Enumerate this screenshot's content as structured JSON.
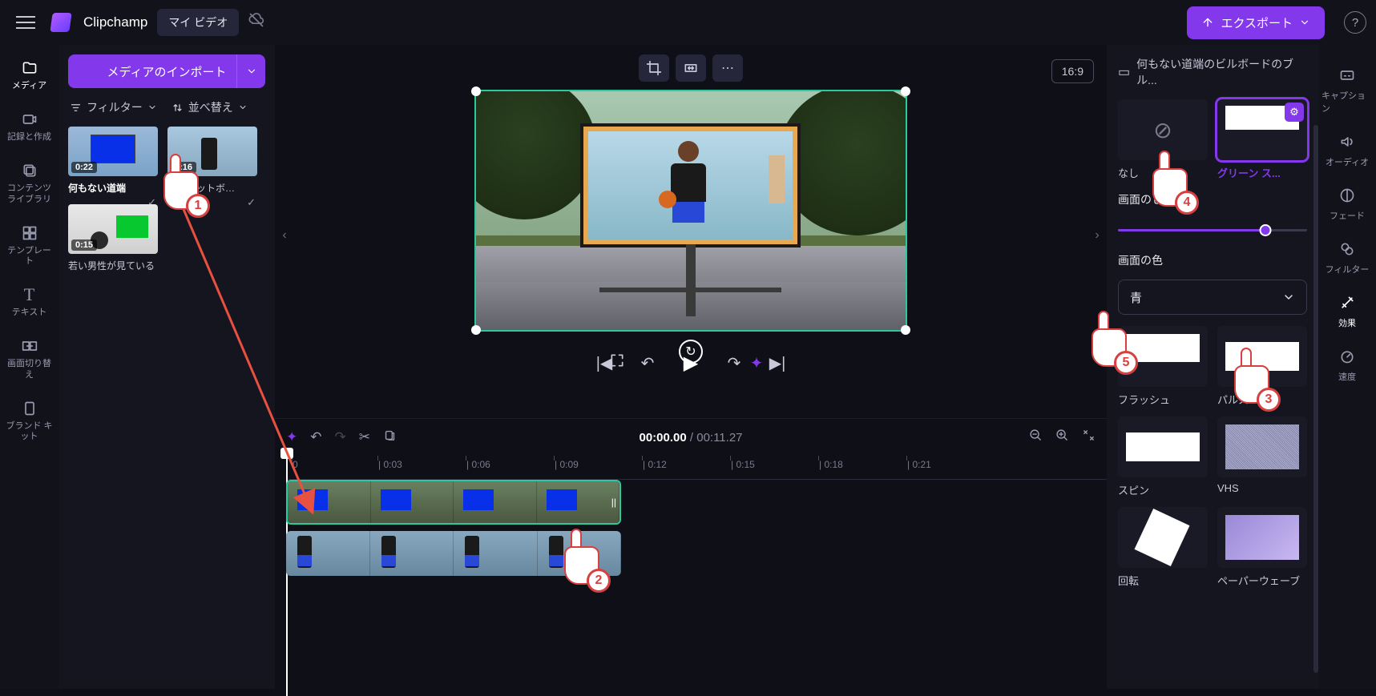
{
  "topbar": {
    "app_name": "Clipchamp",
    "my_videos": "マイ ビデオ",
    "export": "エクスポート"
  },
  "leftrail": [
    {
      "icon": "folder",
      "label": "メディア"
    },
    {
      "icon": "camera",
      "label": "記録と作成"
    },
    {
      "icon": "library",
      "label": "コンテンツ\nライブラリ"
    },
    {
      "icon": "template",
      "label": "テンプレート"
    },
    {
      "icon": "text",
      "label": "テキスト"
    },
    {
      "icon": "transition",
      "label": "画面切り替え"
    },
    {
      "icon": "brand",
      "label": "ブランド キット"
    }
  ],
  "mediapanel": {
    "import": "メディアのインポート",
    "filter": "フィルター",
    "sort": "並べ替え",
    "clips": [
      {
        "dur": "0:22",
        "title": "何もない道端"
      },
      {
        "dur": "0:16",
        "title": "バスケットボ…"
      },
      {
        "dur": "0:15",
        "title": "若い男性が見ている"
      }
    ]
  },
  "canvas": {
    "aspect": "16:9"
  },
  "playbar": {},
  "timeline": {
    "current": "00:00.00",
    "duration": "00:11.27",
    "ticks": [
      "0",
      "0:03",
      "0:06",
      "0:09",
      "0:12",
      "0:15",
      "0:18",
      "0:21"
    ]
  },
  "rightpanel": {
    "title": "何もない道端のビルボードのブル...",
    "fx_none": "なし",
    "fx_gs": "グリーン ス...",
    "threshold": "画面のしきい値",
    "screen_color": "画面の色",
    "color_value": "青",
    "effects": [
      {
        "k": "flash",
        "label": "フラッシュ"
      },
      {
        "k": "pulse",
        "label": "パルス"
      },
      {
        "k": "spin",
        "label": "スピン"
      },
      {
        "k": "vhs",
        "label": "VHS"
      },
      {
        "k": "rotate",
        "label": "回転"
      },
      {
        "k": "paper",
        "label": "ペーパーウェーブ"
      }
    ]
  },
  "rightrail": [
    {
      "label": "キャプション"
    },
    {
      "label": "オーディオ"
    },
    {
      "label": "フェード"
    },
    {
      "label": "フィルター"
    },
    {
      "label": "効果"
    },
    {
      "label": "速度"
    }
  ],
  "annotations": {
    "n1": "1",
    "n2": "2",
    "n3": "3",
    "n4": "4",
    "n5": "5"
  }
}
